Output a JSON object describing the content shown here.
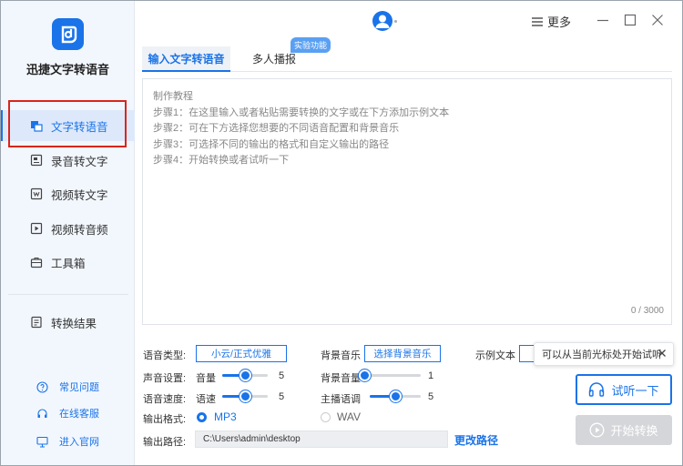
{
  "app": {
    "title": "迅捷文字转语音"
  },
  "sidebar": {
    "items": [
      {
        "label": "文字转语音",
        "icon": "text-to-speech-icon",
        "active": true
      },
      {
        "label": "录音转文字",
        "icon": "recording-icon"
      },
      {
        "label": "视频转文字",
        "icon": "video-text-icon"
      },
      {
        "label": "视频转音频",
        "icon": "video-audio-icon"
      },
      {
        "label": "工具箱",
        "icon": "toolbox-icon"
      },
      {
        "label": "转换结果",
        "icon": "result-icon"
      }
    ],
    "footer": [
      {
        "label": "常见问题",
        "icon": "question-icon"
      },
      {
        "label": "在线客服",
        "icon": "headset-icon"
      },
      {
        "label": "进入官网",
        "icon": "monitor-icon"
      }
    ]
  },
  "header": {
    "more_label": "更多"
  },
  "tabs": [
    {
      "label": "输入文字转语音",
      "active": true
    },
    {
      "label": "多人播报"
    }
  ],
  "badge": "实验功能",
  "editor": {
    "tips": [
      "制作教程",
      "步骤1：在这里输入或者粘贴需要转换的文字或在下方添加示例文本",
      "步骤2：可在下方选择您想要的不同语音配置和背景音乐",
      "步骤3：可选择不同的输出的格式和自定义输出的路径",
      "步骤4：开始转换或者试听一下"
    ],
    "counter": "0 / 3000"
  },
  "settings": {
    "voice_type_label": "语音类型:",
    "voice_type_value": "小云/正式优雅",
    "bgm_label": "背景音乐",
    "bgm_button": "选择背景音乐",
    "sample_label": "示例文本",
    "sound_label": "声音设置:",
    "volume_label": "音量",
    "volume_value": "5",
    "volume_level": 0.5,
    "bgm_volume_label": "背景音量",
    "bgm_volume_value": "1",
    "bgm_volume_level": 0.0,
    "speed_label": "语音速度:",
    "speed_sub_label": "语速",
    "speed_value": "5",
    "speed_level": 0.5,
    "pitch_label": "主播语调",
    "pitch_value": "5",
    "pitch_level": 0.5,
    "format_label": "输出格式:",
    "format_options": [
      "MP3",
      "WAV"
    ],
    "format_selected": "MP3",
    "path_label": "输出路径:",
    "path_value": "C:\\Users\\admin\\desktop",
    "change_path": "更改路径"
  },
  "tooltip": "可以从当前光标处开始试听",
  "actions": {
    "listen": "试听一下",
    "start": "开始转换"
  },
  "colors": {
    "accent": "#1a73e8",
    "highlight": "#d9251c",
    "disabled": "#d4d6d9"
  }
}
